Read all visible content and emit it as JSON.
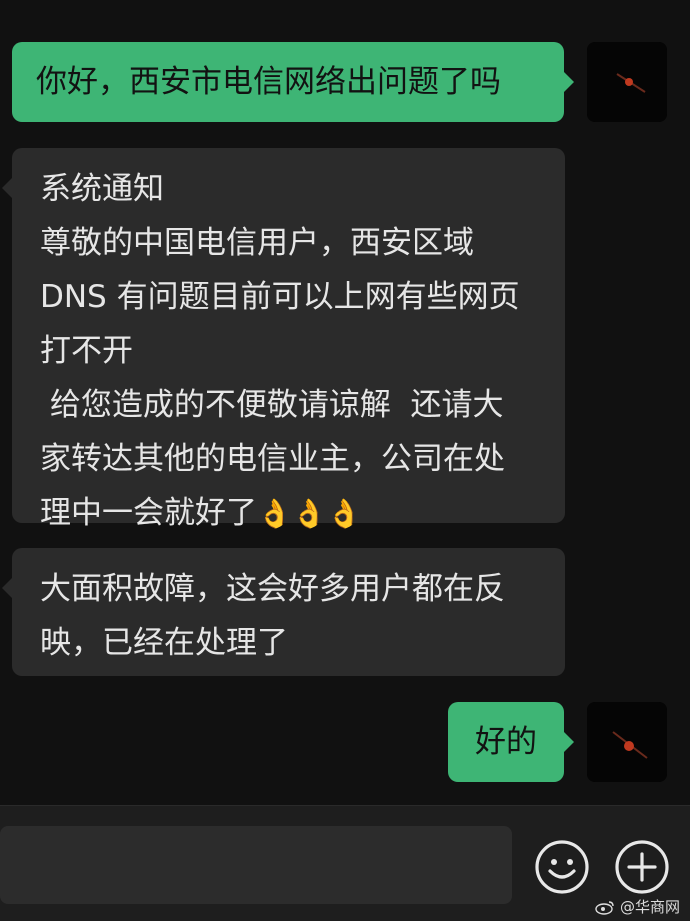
{
  "messages": [
    {
      "direction": "out",
      "lines": [
        "你好，西安市电信网络出问题了吗"
      ]
    },
    {
      "direction": "in",
      "lines": [
        "系统通知",
        "尊敬的中国电信用户，西安区域",
        "DNS 有问题目前可以上网有些网页",
        "打不开",
        " 给您造成的不便敬请谅解  还请大",
        "家转达其他的电信业主，公司在处",
        "理中一会就好了"
      ],
      "emoji": "👌👌👌"
    },
    {
      "direction": "in",
      "lines": [
        "大面积故障，这会好多用户都在反",
        "映，已经在处理了"
      ]
    },
    {
      "direction": "out",
      "lines": [
        "好的"
      ]
    }
  ],
  "input": {
    "value": "",
    "emoji_button_icon": "smiley-icon",
    "more_button_icon": "plus-icon"
  },
  "watermark": {
    "text": "@华商网"
  },
  "colors": {
    "outgoing_bubble": "#3eb575",
    "incoming_bubble": "#2b2b2b",
    "background": "#111111"
  }
}
